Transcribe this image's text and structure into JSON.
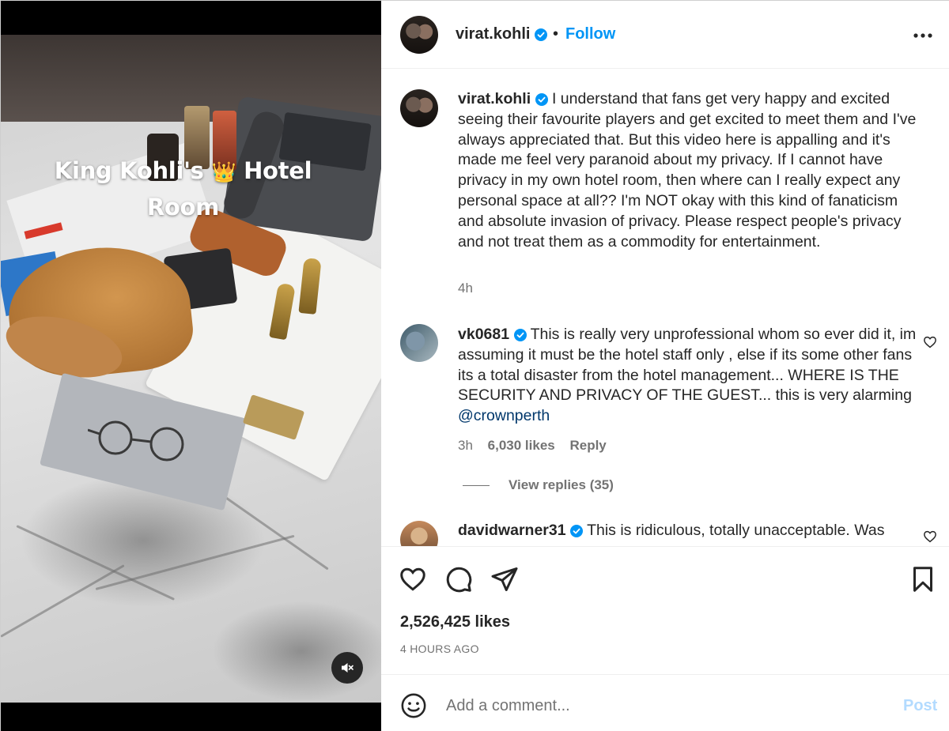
{
  "media": {
    "overlay_line1_pre": "King Kohli's",
    "overlay_crown": "👑",
    "overlay_line1_post": "Hotel",
    "overlay_line2": "Room",
    "mute_icon": "speaker-muted-icon"
  },
  "header": {
    "username": "virat.kohli",
    "separator": "•",
    "follow_label": "Follow",
    "more_icon": "more-options-icon"
  },
  "caption": {
    "username": "virat.kohli",
    "text": "I understand that fans get very happy and excited seeing their favourite players and get excited to meet them and I've always appreciated that. But this video here is appalling and it's made me feel very paranoid about my privacy. If I cannot have privacy in my own hotel room, then where can I really expect any personal space at all?? I'm NOT okay with this kind of fanaticism and absolute invasion of privacy. Please respect people's privacy and not treat them as a commodity for entertainment.",
    "time": "4h"
  },
  "comments": [
    {
      "username": "vk0681",
      "text": "This is really very unprofessional whom so ever did it, im assuming it must be the hotel staff only , else if its some other fans its a total disaster from the hotel management... WHERE IS THE SECURITY AND PRIVACY OF THE GUEST... this is very alarming",
      "mention": "@crownperth",
      "time": "3h",
      "likes": "6,030 likes",
      "reply_label": "Reply",
      "view_replies": "View replies (35)"
    },
    {
      "username": "davidwarner31",
      "text": "This is ridiculous, totally unacceptable. Was"
    }
  ],
  "actions": {
    "likes": "2,526,425 likes",
    "timestamp": "4 HOURS AGO"
  },
  "add_comment": {
    "placeholder": "Add a comment...",
    "post_label": "Post"
  },
  "colors": {
    "accent": "#0095f6",
    "verified": "#0095f6",
    "post_disabled": "#b3dbff",
    "secondary_text": "#737373"
  }
}
